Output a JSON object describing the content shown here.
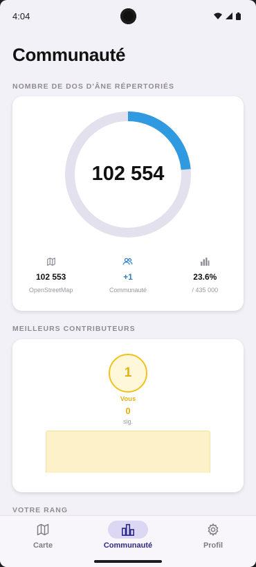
{
  "status_bar": {
    "time": "4:04"
  },
  "page_title": "Communauté",
  "sections": {
    "count_label": "NOMBRE DE DOS D'ÂNE RÉPERTORIÉS",
    "top_label": "MEILLEURS CONTRIBUTEURS",
    "rank_label": "VOTRE RANG"
  },
  "donut": {
    "total": "102 554",
    "progress": 0.236,
    "track_color": "#e4e1ef",
    "fill_color": "#2f9ae0"
  },
  "stats": [
    {
      "icon": "map-icon",
      "value": "102 553",
      "label": "OpenStreetMap",
      "color": "#111111"
    },
    {
      "icon": "users-icon",
      "value": "+1",
      "label": "Communauté",
      "color": "#2f7fc8"
    },
    {
      "icon": "bar-chart-icon",
      "value": "23.6%",
      "label": "/ 435 000",
      "color": "#111111"
    }
  ],
  "contributors": {
    "rank": "1",
    "you_label": "Vous",
    "you_value": "0",
    "you_unit": "sig."
  },
  "nav": {
    "items": [
      {
        "label": "Carte",
        "icon": "map-icon",
        "active": false
      },
      {
        "label": "Communauté",
        "icon": "bar-chart-icon",
        "active": true
      },
      {
        "label": "Profil",
        "icon": "gear-icon",
        "active": false
      }
    ]
  }
}
